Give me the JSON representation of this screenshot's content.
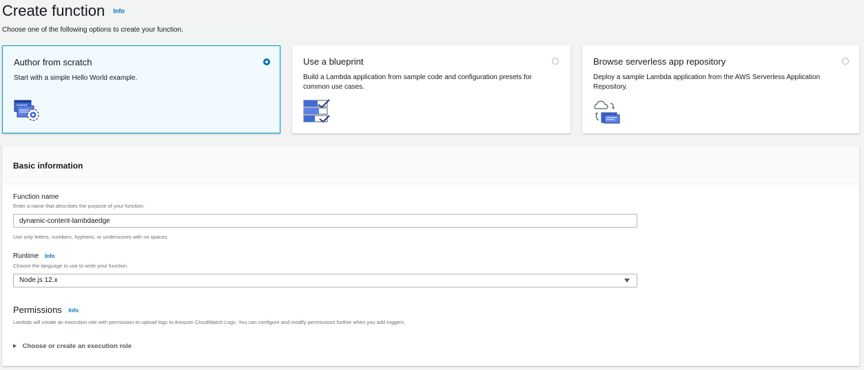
{
  "header": {
    "title": "Create function",
    "info_label": "Info",
    "subtitle": "Choose one of the following options to create your function."
  },
  "options": [
    {
      "title": "Author from scratch",
      "description": "Start with a simple Hello World example.",
      "selected": true,
      "icon": "author-from-scratch-icon"
    },
    {
      "title": "Use a blueprint",
      "description": "Build a Lambda application from sample code and configuration presets for common use cases.",
      "selected": false,
      "icon": "blueprint-icon"
    },
    {
      "title": "Browse serverless app repository",
      "description": "Deploy a sample Lambda application from the AWS Serverless Application Repository.",
      "selected": false,
      "icon": "serverless-repository-icon"
    }
  ],
  "basic_info": {
    "title": "Basic information",
    "function_name": {
      "label": "Function name",
      "description": "Enter a name that describes the purpose of your function.",
      "value": "dynamic-content-lambdaedge",
      "hint": "Use only letters, numbers, hyphens, or underscores with no spaces."
    },
    "runtime": {
      "label": "Runtime",
      "info_label": "Info",
      "description": "Choose the language to use to write your function.",
      "value": "Node.js 12.x"
    },
    "permissions": {
      "title": "Permissions",
      "info_label": "Info",
      "description": "Lambda will create an execution role with permission to upload logs to Amazon CloudWatch Logs. You can configure and modify permissions further when you add triggers.",
      "expander_label": "Choose or create an execution role"
    }
  },
  "colors": {
    "accent": "#0073bb",
    "selected_border": "#00a1c9",
    "selected_bg": "#f1faff",
    "page_bg": "#f2f3f3",
    "icon_blue": "#3f6ad8"
  }
}
